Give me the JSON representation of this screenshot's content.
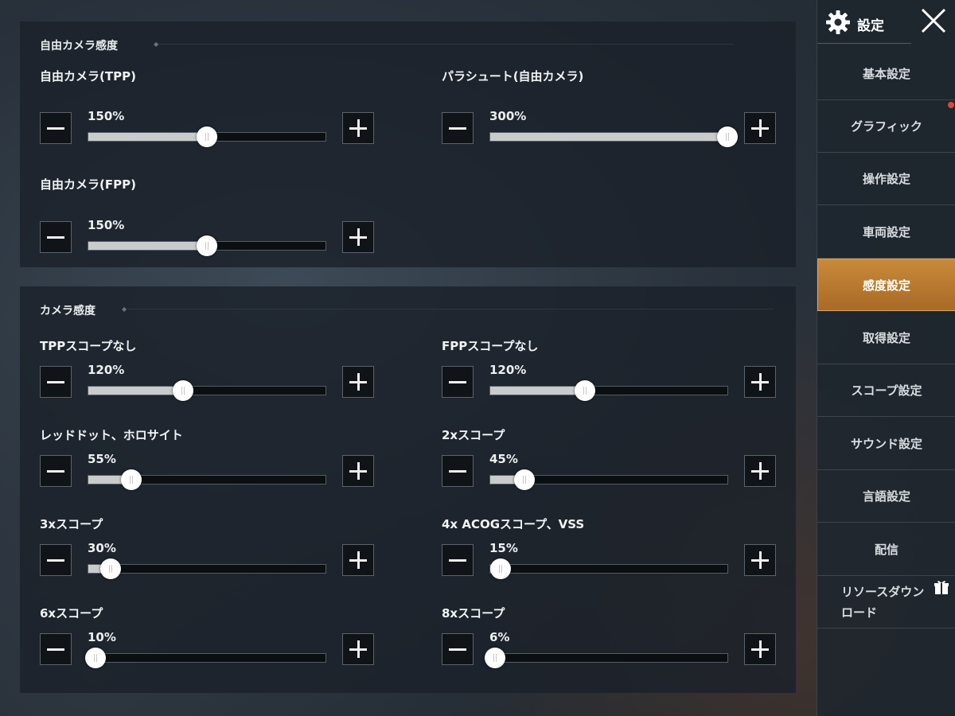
{
  "header": {
    "title": "設定"
  },
  "sidebar": {
    "items": [
      {
        "label": "基本設定"
      },
      {
        "label": "グラフィック"
      },
      {
        "label": "操作設定"
      },
      {
        "label": "車両設定"
      },
      {
        "label": "感度設定"
      },
      {
        "label": "取得設定"
      },
      {
        "label": "スコープ設定"
      },
      {
        "label": "サウンド設定"
      },
      {
        "label": "言語設定"
      },
      {
        "label": "配信"
      },
      {
        "label": "リソースダウンロード",
        "line1": "リソースダウン",
        "line2": "ロード"
      }
    ],
    "active_item": "感度設定",
    "notification_item": "グラフィック"
  },
  "free_camera": {
    "title": "自由カメラ感度",
    "settings": [
      {
        "label": "自由カメラ(TPP)",
        "value_text": "150%",
        "level": 0.5
      },
      {
        "label": "パラシュート(自由カメラ)",
        "value_text": "300%",
        "level": 1.0
      },
      {
        "label": "自由カメラ(FPP)",
        "value_text": "150%",
        "level": 0.5
      }
    ]
  },
  "camera": {
    "title": "カメラ感度",
    "settings": [
      {
        "label": "TPPスコープなし",
        "value_text": "120%",
        "level": 0.4
      },
      {
        "label": "FPPスコープなし",
        "value_text": "120%",
        "level": 0.4
      },
      {
        "label": "レッドドット、ホロサイト",
        "value_text": "55%",
        "level": 0.18
      },
      {
        "label": "2xスコープ",
        "value_text": "45%",
        "level": 0.145
      },
      {
        "label": "3xスコープ",
        "value_text": "30%",
        "level": 0.095
      },
      {
        "label": "4x ACOGスコープ、VSS",
        "value_text": "15%",
        "level": 0.045
      },
      {
        "label": "6xスコープ",
        "value_text": "10%",
        "level": 0.03
      },
      {
        "label": "8xスコープ",
        "value_text": "6%",
        "level": 0.02
      }
    ]
  },
  "colors": {
    "accent": "#c98a3a",
    "notification": "#e0453a"
  },
  "icons": {
    "header": "gear-icon",
    "close": "close-icon",
    "minus": "minus-icon",
    "plus": "plus-icon",
    "gift": "gift-icon"
  }
}
